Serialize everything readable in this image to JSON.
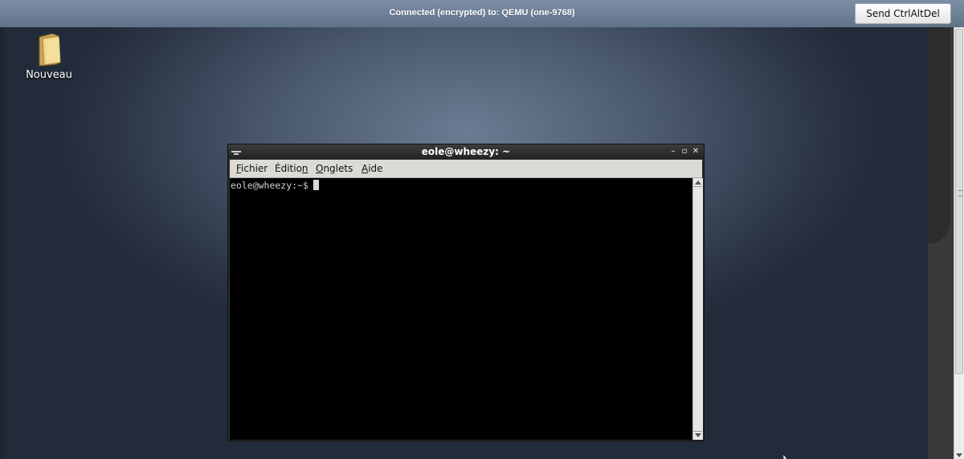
{
  "vnc": {
    "status_text": "Connected (encrypted) to: QEMU (one-9768)",
    "send_button_label": "Send CtrlAltDel"
  },
  "desktop": {
    "icons": [
      {
        "label": "Nouveau",
        "icon": "folder-icon"
      }
    ]
  },
  "terminal": {
    "title": "eole@wheezy: ~",
    "window_buttons": [
      "minimize-icon",
      "maximize-icon",
      "close-icon"
    ],
    "menu": [
      {
        "label": "Fichier",
        "mnemonic": "F"
      },
      {
        "label": "Édition",
        "mnemonic": "n"
      },
      {
        "label": "Onglets",
        "mnemonic": "O"
      },
      {
        "label": "Aide",
        "mnemonic": "A"
      }
    ],
    "prompt": "eole@wheezy:~$"
  },
  "colors": {
    "terminal_bg": "#000000",
    "menubar_bg": "#dcdad5",
    "titlebar_bg": "#2b2b2b",
    "vnc_bar_bg": "#6f8298"
  }
}
